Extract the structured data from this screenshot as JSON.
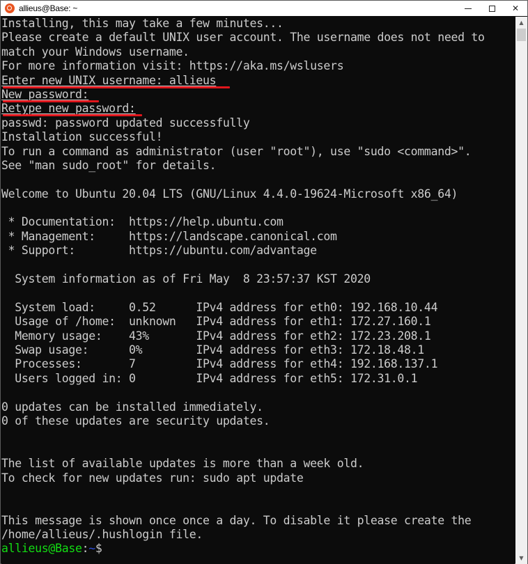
{
  "window": {
    "title": "allieus@Base: ~",
    "app_icon": "ubuntu-logo-icon",
    "controls": {
      "minimize": "minimize-icon",
      "maximize": "maximize-icon",
      "close_label": "✕"
    }
  },
  "terminal": {
    "lines": [
      "Installing, this may take a few minutes...",
      "Please create a default UNIX user account. The username does not need to",
      "match your Windows username.",
      "For more information visit: https://aka.ms/wslusers",
      "Enter new UNIX username: allieus",
      "New password:",
      "Retype new password:",
      "passwd: password updated successfully",
      "Installation successful!",
      "To run a command as administrator (user \"root\"), use \"sudo <command>\".",
      "See \"man sudo_root\" for details.",
      "",
      "Welcome to Ubuntu 20.04 LTS (GNU/Linux 4.4.0-19624-Microsoft x86_64)",
      "",
      " * Documentation:  https://help.ubuntu.com",
      " * Management:     https://landscape.canonical.com",
      " * Support:        https://ubuntu.com/advantage",
      "",
      "  System information as of Fri May  8 23:57:37 KST 2020",
      "",
      "  System load:     0.52      IPv4 address for eth0: 192.168.10.44",
      "  Usage of /home:  unknown   IPv4 address for eth1: 172.27.160.1",
      "  Memory usage:    43%       IPv4 address for eth2: 172.23.208.1",
      "  Swap usage:      0%        IPv4 address for eth3: 172.18.48.1",
      "  Processes:       7         IPv4 address for eth4: 192.168.137.1",
      "  Users logged in: 0         IPv4 address for eth5: 172.31.0.1",
      "",
      "0 updates can be installed immediately.",
      "0 of these updates are security updates.",
      "",
      "",
      "The list of available updates is more than a week old.",
      "To check for new updates run: sudo apt update",
      "",
      "",
      "This message is shown once once a day. To disable it please create the",
      "/home/allieus/.hushlogin file."
    ],
    "prompt": {
      "user_host": "allieus@Base",
      "colon": ":",
      "path": "~",
      "symbol": "$"
    }
  },
  "annotations": {
    "highlight_color": "#e0161c",
    "highlighted_lines": [
      "Enter new UNIX username: allieus",
      "New password:",
      "Retype new password:"
    ]
  },
  "scrollbar": {
    "up_arrow": "▲",
    "down_arrow": "▼"
  }
}
